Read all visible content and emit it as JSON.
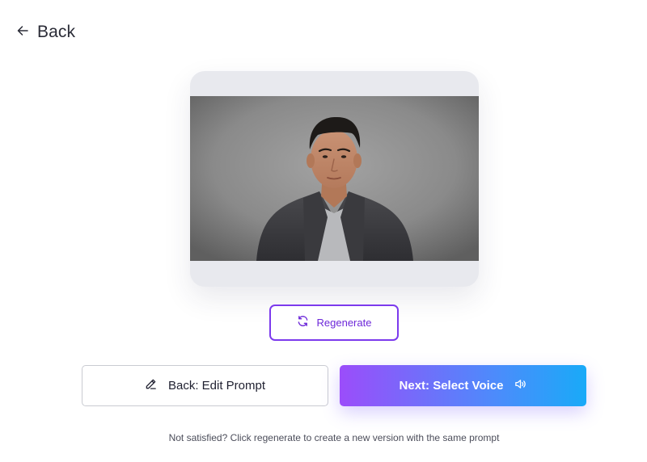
{
  "nav": {
    "back_label": "Back"
  },
  "preview": {
    "image_alt": "AI-generated portrait of a man in a gray blazer"
  },
  "actions": {
    "regenerate_label": "Regenerate",
    "edit_prompt_label": "Back: Edit Prompt",
    "next_label": "Next: Select Voice"
  },
  "hint": {
    "text": "Not satisfied? Click regenerate to create a new version with the same prompt"
  },
  "icons": {
    "back": "arrow-left-icon",
    "regenerate": "refresh-icon",
    "edit": "pencil-icon",
    "voice": "speaker-icon"
  },
  "colors": {
    "accent_purple": "#7c3aed",
    "gradient_start": "#9b4dfa",
    "gradient_end": "#19aaf8",
    "card_bg": "#e8e9ee"
  }
}
